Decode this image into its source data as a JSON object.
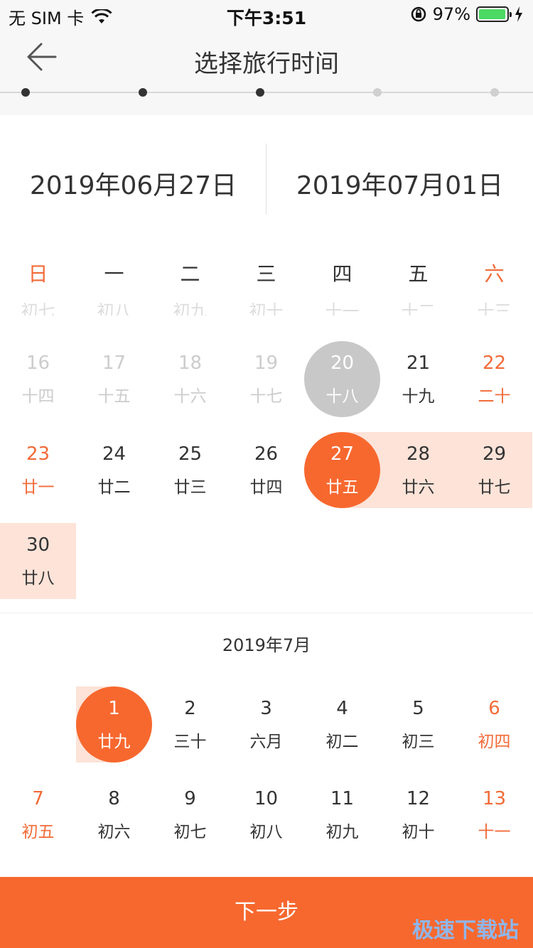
{
  "status_bar": {
    "carrier": "无 SIM 卡",
    "time": "下午3:51",
    "battery": "97%",
    "battery_level": 0.97
  },
  "header": {
    "title": "选择旅行时间",
    "steps_total": 5,
    "steps_done": 3
  },
  "range": {
    "start": "2019年06月27日",
    "end": "2019年07月01日"
  },
  "weekdays": [
    "日",
    "一",
    "二",
    "三",
    "四",
    "五",
    "六"
  ],
  "partial_row": [
    "初七",
    "初八",
    "初九",
    "初十",
    "十一",
    "十二",
    "十三"
  ],
  "june": {
    "days": [
      {
        "d": "16",
        "l": "十四",
        "col": 0,
        "row": 0,
        "state": "past"
      },
      {
        "d": "17",
        "l": "十五",
        "col": 1,
        "row": 0,
        "state": "past"
      },
      {
        "d": "18",
        "l": "十六",
        "col": 2,
        "row": 0,
        "state": "past"
      },
      {
        "d": "19",
        "l": "十七",
        "col": 3,
        "row": 0,
        "state": "past"
      },
      {
        "d": "20",
        "l": "十八",
        "col": 4,
        "row": 0,
        "state": "today"
      },
      {
        "d": "21",
        "l": "十九",
        "col": 5,
        "row": 0,
        "state": "normal"
      },
      {
        "d": "22",
        "l": "二十",
        "col": 6,
        "row": 0,
        "state": "weekend"
      },
      {
        "d": "23",
        "l": "廿一",
        "col": 0,
        "row": 1,
        "state": "weekend"
      },
      {
        "d": "24",
        "l": "廿二",
        "col": 1,
        "row": 1,
        "state": "normal"
      },
      {
        "d": "25",
        "l": "廿三",
        "col": 2,
        "row": 1,
        "state": "normal"
      },
      {
        "d": "26",
        "l": "廿四",
        "col": 3,
        "row": 1,
        "state": "normal"
      },
      {
        "d": "27",
        "l": "廿五",
        "col": 4,
        "row": 1,
        "state": "start"
      },
      {
        "d": "28",
        "l": "廿六",
        "col": 5,
        "row": 1,
        "state": "inrange"
      },
      {
        "d": "29",
        "l": "廿七",
        "col": 6,
        "row": 1,
        "state": "inrange"
      },
      {
        "d": "30",
        "l": "廿八",
        "col": 0,
        "row": 2,
        "state": "inrange"
      }
    ]
  },
  "july": {
    "title": "2019年7月",
    "days": [
      {
        "d": "1",
        "l": "廿九",
        "col": 1,
        "row": 0,
        "state": "end"
      },
      {
        "d": "2",
        "l": "三十",
        "col": 2,
        "row": 0,
        "state": "normal"
      },
      {
        "d": "3",
        "l": "六月",
        "col": 3,
        "row": 0,
        "state": "normal"
      },
      {
        "d": "4",
        "l": "初二",
        "col": 4,
        "row": 0,
        "state": "normal"
      },
      {
        "d": "5",
        "l": "初三",
        "col": 5,
        "row": 0,
        "state": "normal"
      },
      {
        "d": "6",
        "l": "初四",
        "col": 6,
        "row": 0,
        "state": "weekend"
      },
      {
        "d": "7",
        "l": "初五",
        "col": 0,
        "row": 1,
        "state": "weekend"
      },
      {
        "d": "8",
        "l": "初六",
        "col": 1,
        "row": 1,
        "state": "normal"
      },
      {
        "d": "9",
        "l": "初七",
        "col": 2,
        "row": 1,
        "state": "normal"
      },
      {
        "d": "10",
        "l": "初八",
        "col": 3,
        "row": 1,
        "state": "normal"
      },
      {
        "d": "11",
        "l": "初九",
        "col": 4,
        "row": 1,
        "state": "normal"
      },
      {
        "d": "12",
        "l": "初十",
        "col": 5,
        "row": 1,
        "state": "normal"
      },
      {
        "d": "13",
        "l": "十一",
        "col": 6,
        "row": 1,
        "state": "weekend"
      }
    ]
  },
  "footer": {
    "next_label": "下一步",
    "watermark": "极速下载站"
  },
  "colors": {
    "accent": "#f7682f",
    "range_bg": "#fde3d8",
    "weekend_text": "#f26b38",
    "today_bg": "#c8c8c8",
    "watermark": "#8fb6ea"
  }
}
